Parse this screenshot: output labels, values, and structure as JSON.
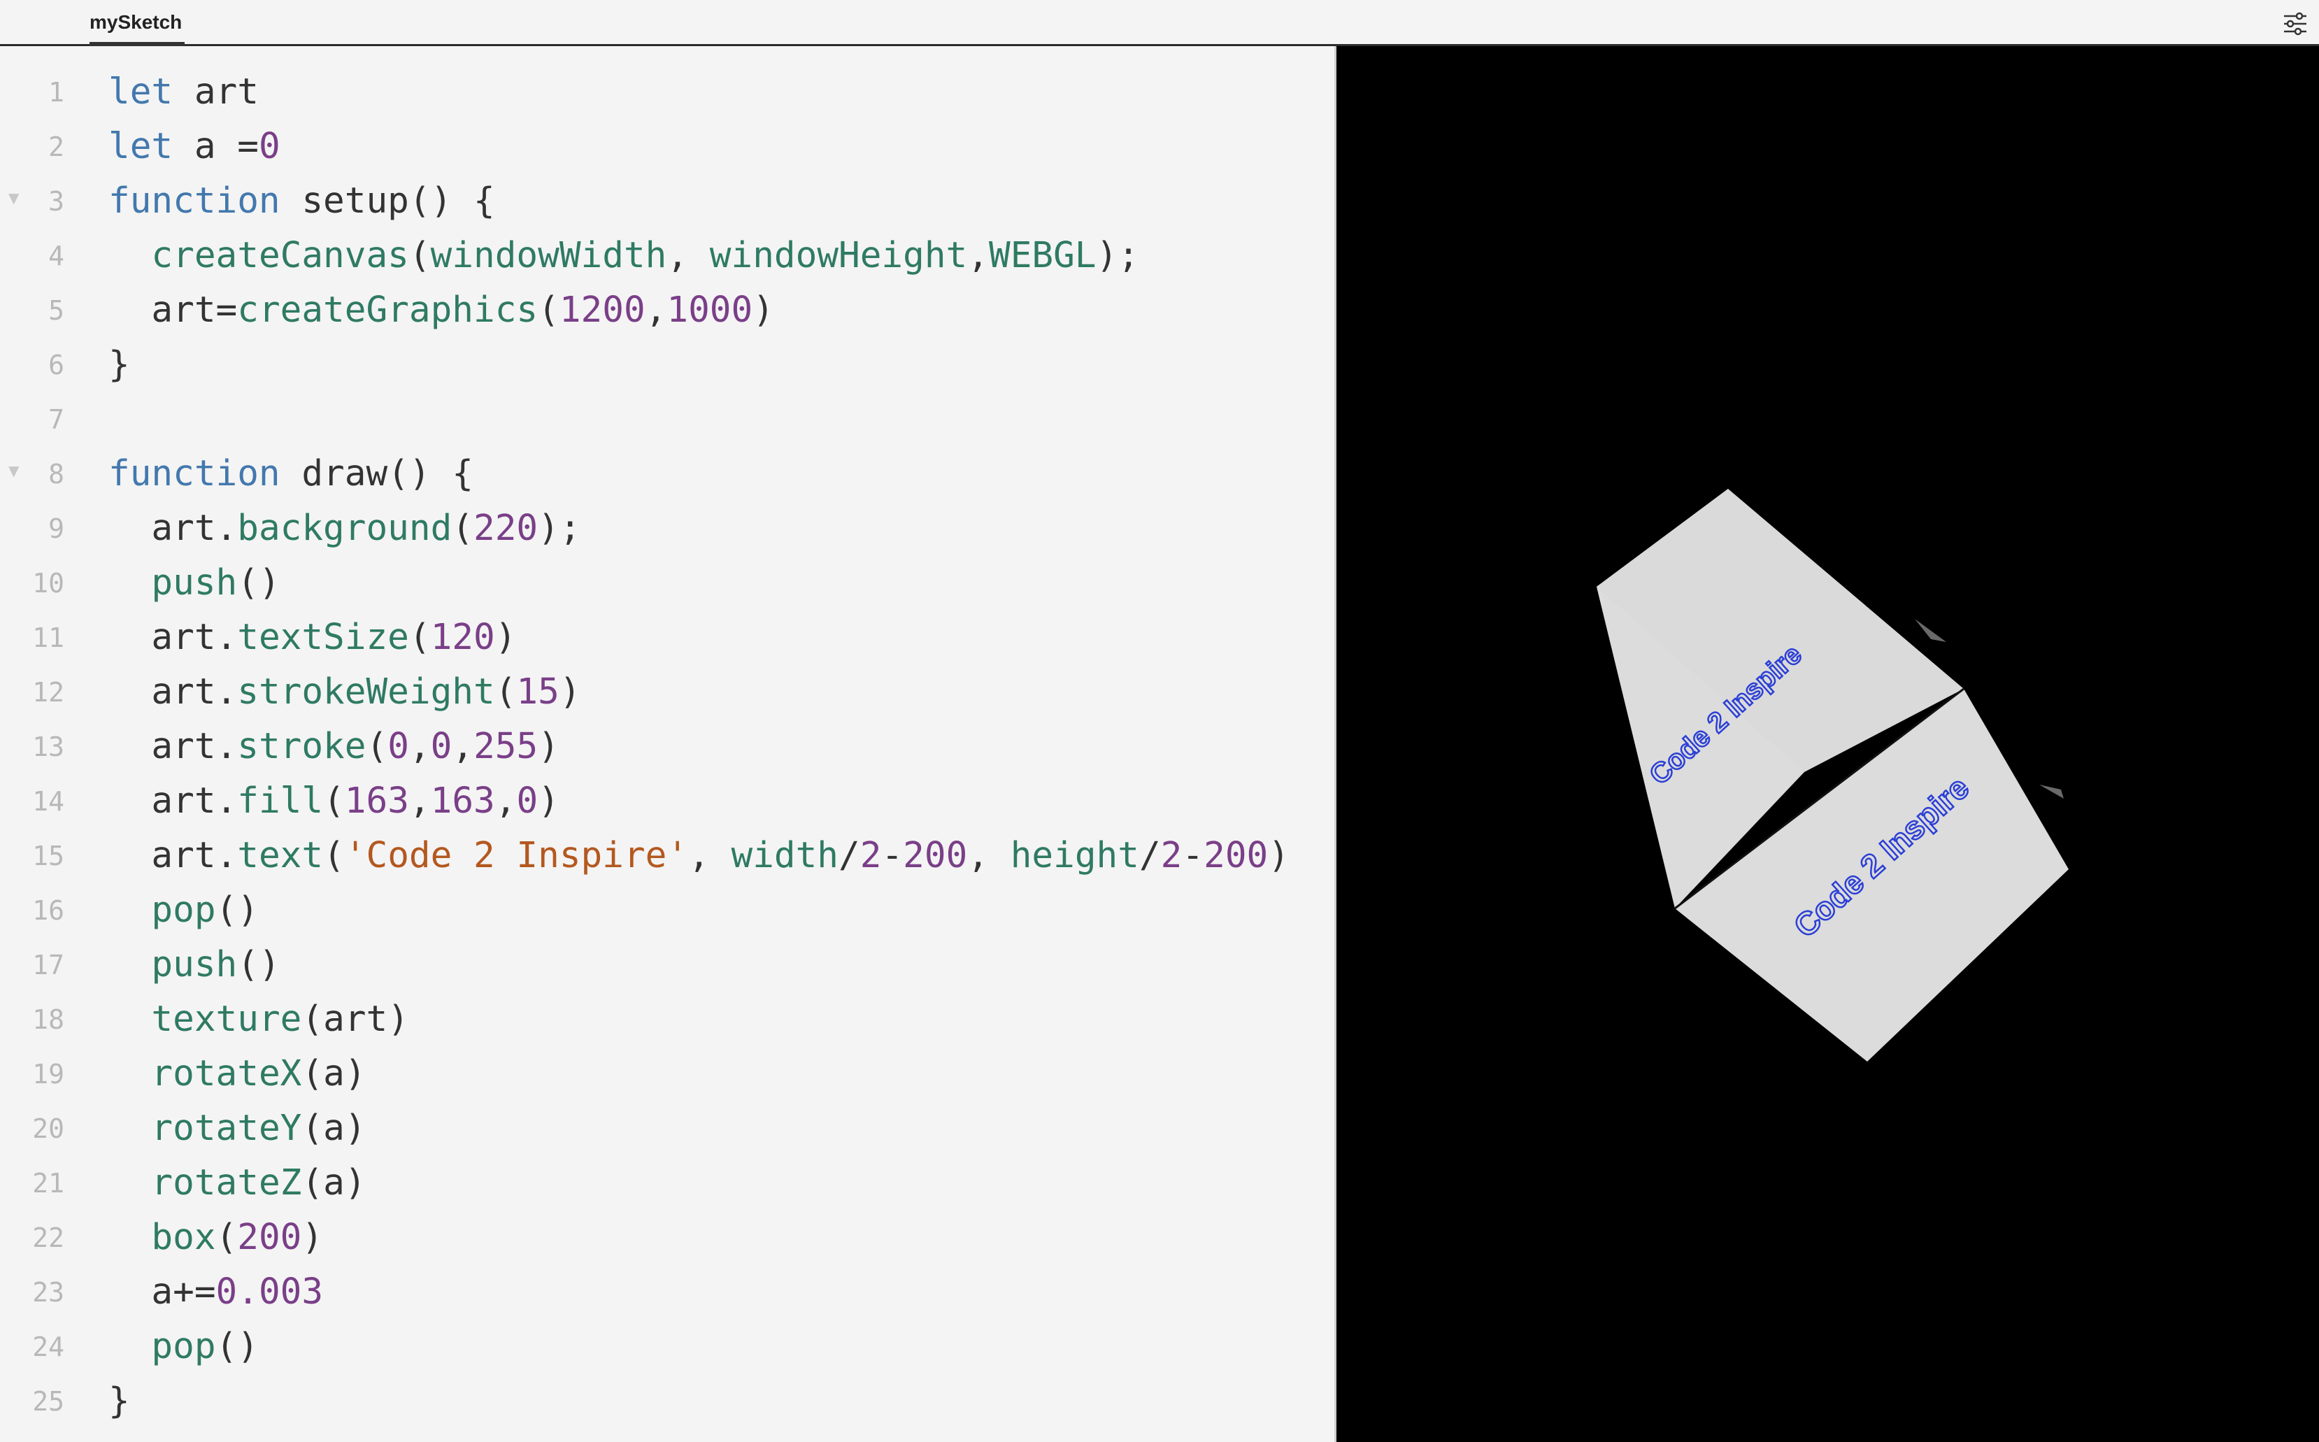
{
  "tab": {
    "label": "mySketch"
  },
  "settings_icon": "sliders-icon",
  "code_lines": [
    {
      "n": "1",
      "fold": false,
      "tokens": [
        [
          "kw",
          "let"
        ],
        [
          "pl",
          " art"
        ]
      ]
    },
    {
      "n": "2",
      "fold": false,
      "tokens": [
        [
          "kw",
          "let"
        ],
        [
          "pl",
          " a ="
        ],
        [
          "num",
          "0"
        ]
      ]
    },
    {
      "n": "3",
      "fold": true,
      "tokens": [
        [
          "kw",
          "function"
        ],
        [
          "pl",
          " setup() {"
        ]
      ]
    },
    {
      "n": "4",
      "fold": false,
      "tokens": [
        [
          "pl",
          "  "
        ],
        [
          "fn",
          "createCanvas"
        ],
        [
          "pl",
          "("
        ],
        [
          "fn",
          "windowWidth"
        ],
        [
          "pl",
          ", "
        ],
        [
          "fn",
          "windowHeight"
        ],
        [
          "pl",
          ","
        ],
        [
          "fn",
          "WEBGL"
        ],
        [
          "pl",
          ");"
        ]
      ]
    },
    {
      "n": "5",
      "fold": false,
      "tokens": [
        [
          "pl",
          "  art="
        ],
        [
          "fn",
          "createGraphics"
        ],
        [
          "pl",
          "("
        ],
        [
          "num",
          "1200"
        ],
        [
          "pl",
          ","
        ],
        [
          "num",
          "1000"
        ],
        [
          "pl",
          ")"
        ]
      ]
    },
    {
      "n": "6",
      "fold": false,
      "tokens": [
        [
          "pl",
          "}"
        ]
      ]
    },
    {
      "n": "7",
      "fold": false,
      "tokens": []
    },
    {
      "n": "8",
      "fold": true,
      "tokens": [
        [
          "kw",
          "function"
        ],
        [
          "pl",
          " draw() {"
        ]
      ]
    },
    {
      "n": "9",
      "fold": false,
      "tokens": [
        [
          "pl",
          "  art."
        ],
        [
          "fn",
          "background"
        ],
        [
          "pl",
          "("
        ],
        [
          "num",
          "220"
        ],
        [
          "pl",
          ");"
        ]
      ]
    },
    {
      "n": "10",
      "fold": false,
      "tokens": [
        [
          "pl",
          "  "
        ],
        [
          "fn",
          "push"
        ],
        [
          "pl",
          "()"
        ]
      ]
    },
    {
      "n": "11",
      "fold": false,
      "tokens": [
        [
          "pl",
          "  art."
        ],
        [
          "fn",
          "textSize"
        ],
        [
          "pl",
          "("
        ],
        [
          "num",
          "120"
        ],
        [
          "pl",
          ")"
        ]
      ]
    },
    {
      "n": "12",
      "fold": false,
      "tokens": [
        [
          "pl",
          "  art."
        ],
        [
          "fn",
          "strokeWeight"
        ],
        [
          "pl",
          "("
        ],
        [
          "num",
          "15"
        ],
        [
          "pl",
          ")"
        ]
      ]
    },
    {
      "n": "13",
      "fold": false,
      "tokens": [
        [
          "pl",
          "  art."
        ],
        [
          "fn",
          "stroke"
        ],
        [
          "pl",
          "("
        ],
        [
          "num",
          "0"
        ],
        [
          "pl",
          ","
        ],
        [
          "num",
          "0"
        ],
        [
          "pl",
          ","
        ],
        [
          "num",
          "255"
        ],
        [
          "pl",
          ")"
        ]
      ]
    },
    {
      "n": "14",
      "fold": false,
      "tokens": [
        [
          "pl",
          "  art."
        ],
        [
          "fn",
          "fill"
        ],
        [
          "pl",
          "("
        ],
        [
          "num",
          "163"
        ],
        [
          "pl",
          ","
        ],
        [
          "num",
          "163"
        ],
        [
          "pl",
          ","
        ],
        [
          "num",
          "0"
        ],
        [
          "pl",
          ")"
        ]
      ]
    },
    {
      "n": "15",
      "fold": false,
      "tokens": [
        [
          "pl",
          "  art."
        ],
        [
          "fn",
          "text"
        ],
        [
          "pl",
          "("
        ],
        [
          "str",
          "'Code 2 Inspire'"
        ],
        [
          "pl",
          ", "
        ],
        [
          "fn",
          "width"
        ],
        [
          "pl",
          "/"
        ],
        [
          "num",
          "2"
        ],
        [
          "pl",
          "-"
        ],
        [
          "num",
          "200"
        ],
        [
          "pl",
          ", "
        ],
        [
          "fn",
          "height"
        ],
        [
          "pl",
          "/"
        ],
        [
          "num",
          "2"
        ],
        [
          "pl",
          "-"
        ],
        [
          "num",
          "200"
        ],
        [
          "pl",
          ")"
        ]
      ]
    },
    {
      "n": "16",
      "fold": false,
      "tokens": [
        [
          "pl",
          "  "
        ],
        [
          "fn",
          "pop"
        ],
        [
          "pl",
          "()"
        ]
      ]
    },
    {
      "n": "17",
      "fold": false,
      "tokens": [
        [
          "pl",
          "  "
        ],
        [
          "fn",
          "push"
        ],
        [
          "pl",
          "()"
        ]
      ]
    },
    {
      "n": "18",
      "fold": false,
      "tokens": [
        [
          "pl",
          "  "
        ],
        [
          "fn",
          "texture"
        ],
        [
          "pl",
          "(art)"
        ]
      ]
    },
    {
      "n": "19",
      "fold": false,
      "tokens": [
        [
          "pl",
          "  "
        ],
        [
          "fn",
          "rotateX"
        ],
        [
          "pl",
          "(a)"
        ]
      ]
    },
    {
      "n": "20",
      "fold": false,
      "tokens": [
        [
          "pl",
          "  "
        ],
        [
          "fn",
          "rotateY"
        ],
        [
          "pl",
          "(a)"
        ]
      ]
    },
    {
      "n": "21",
      "fold": false,
      "tokens": [
        [
          "pl",
          "  "
        ],
        [
          "fn",
          "rotateZ"
        ],
        [
          "pl",
          "(a)"
        ]
      ]
    },
    {
      "n": "22",
      "fold": false,
      "tokens": [
        [
          "pl",
          "  "
        ],
        [
          "fn",
          "box"
        ],
        [
          "pl",
          "("
        ],
        [
          "num",
          "200"
        ],
        [
          "pl",
          ")"
        ]
      ]
    },
    {
      "n": "23",
      "fold": false,
      "tokens": [
        [
          "pl",
          "  a+="
        ],
        [
          "num",
          "0.003"
        ]
      ]
    },
    {
      "n": "24",
      "fold": false,
      "tokens": [
        [
          "pl",
          "  "
        ],
        [
          "fn",
          "pop"
        ],
        [
          "pl",
          "()"
        ]
      ]
    },
    {
      "n": "25",
      "fold": false,
      "tokens": [
        [
          "pl",
          "}"
        ]
      ]
    }
  ],
  "canvas": {
    "background": "#000000",
    "face_color": "#dcdcdc",
    "texture_text": "Code 2 Inspire",
    "texture_text_color": "#2b3fd6"
  },
  "colors": {
    "keyword": "#4378ad",
    "function": "#2f7a63",
    "number": "#7a3f88",
    "string": "#b4581f",
    "plain": "#333333"
  }
}
